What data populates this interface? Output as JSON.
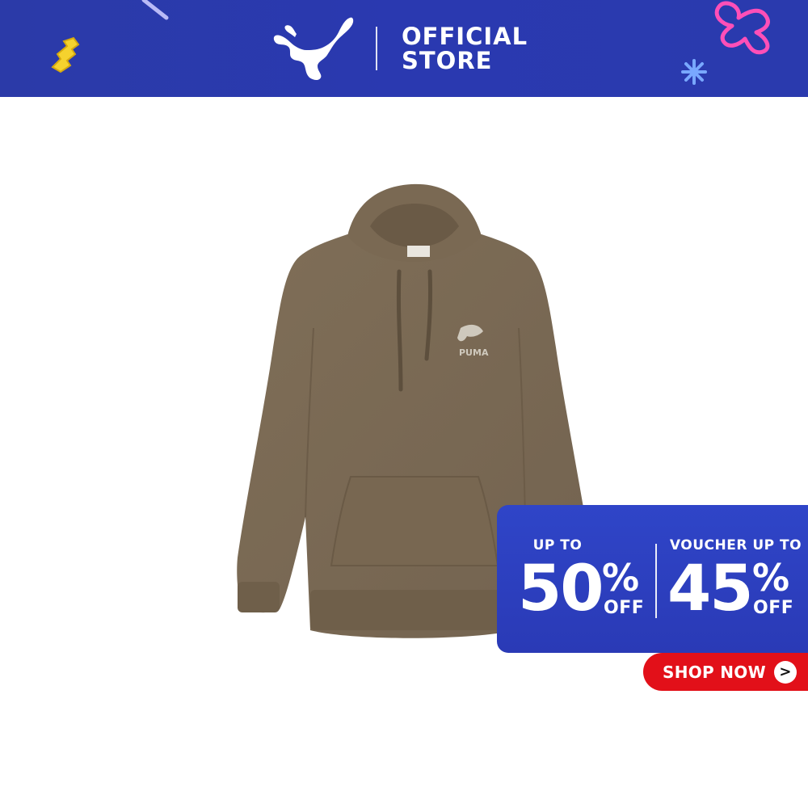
{
  "header": {
    "brand_icon": "puma-cat-logo",
    "store_line1": "OFFICIAL",
    "store_line2": "STORE",
    "background_color": "#2b3aa8",
    "decorations": [
      "yellow-zigzag",
      "pink-squiggle",
      "blue-star",
      "light-streak"
    ]
  },
  "product": {
    "type": "hoodie",
    "color": "#7b6a54",
    "chest_logo_text": "PUMA"
  },
  "promo": {
    "left_label": "UP TO",
    "left_value": "50",
    "left_percent": "%",
    "left_suffix": "OFF",
    "right_label": "VOUCHER UP TO",
    "right_value": "45",
    "right_percent": "%",
    "right_suffix": "OFF",
    "background_color": "#2f45c8"
  },
  "cta": {
    "label": "SHOP NOW",
    "arrow_glyph": ">",
    "background_color": "#e21019"
  }
}
